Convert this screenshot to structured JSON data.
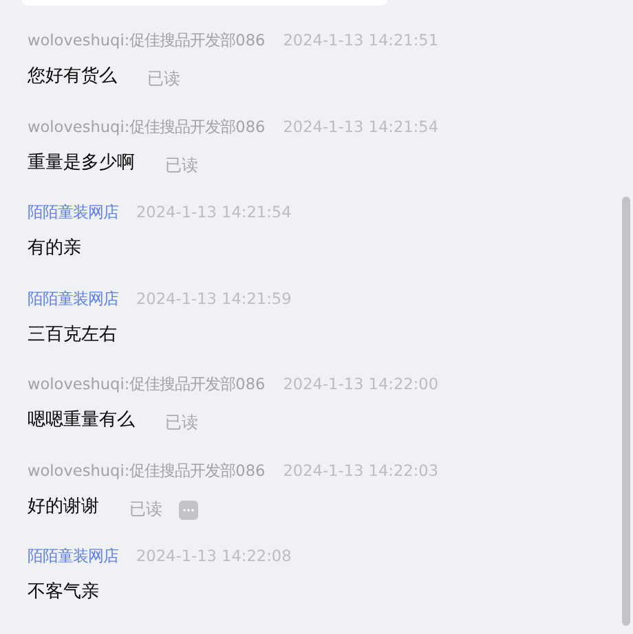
{
  "messages": [
    {
      "sender": "woloveshuqi:促佳搜品开发部086",
      "kind": "buyer",
      "time": "2024-1-13 14:21:51",
      "text": "您好有货么",
      "receipt": "已读",
      "menu": false
    },
    {
      "sender": "woloveshuqi:促佳搜品开发部086",
      "kind": "buyer",
      "time": "2024-1-13 14:21:54",
      "text": "重量是多少啊",
      "receipt": "已读",
      "menu": false
    },
    {
      "sender": "陌陌童装网店",
      "kind": "seller",
      "time": "2024-1-13 14:21:54",
      "text": "有的亲",
      "menu": false
    },
    {
      "sender": "陌陌童装网店",
      "kind": "seller",
      "time": "2024-1-13 14:21:59",
      "text": "三百克左右",
      "menu": false
    },
    {
      "sender": "woloveshuqi:促佳搜品开发部086",
      "kind": "buyer",
      "time": "2024-1-13 14:22:00",
      "text": "嗯嗯重量有么",
      "receipt": "已读",
      "menu": false
    },
    {
      "sender": "woloveshuqi:促佳搜品开发部086",
      "kind": "buyer",
      "time": "2024-1-13 14:22:03",
      "text": "好的谢谢",
      "receipt": "已读",
      "menu": true
    },
    {
      "sender": "陌陌童装网店",
      "kind": "seller",
      "time": "2024-1-13 14:22:08",
      "text": "不客气亲",
      "menu": false
    }
  ]
}
